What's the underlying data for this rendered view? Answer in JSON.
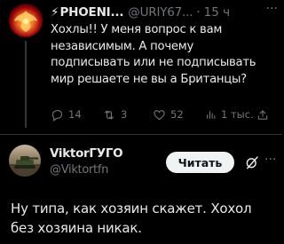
{
  "parent_tweet": {
    "bolt": "⚡",
    "author_name": "PHOENI...",
    "handle": "@URIY67...",
    "separator": "·",
    "time": "15 ч",
    "more": "···",
    "text_lines": [
      "Хохлы!! У меня вопрос к вам",
      "независимым. А почему",
      "подписывать или не подписывать",
      "мир решаете не вы а Британцы?"
    ],
    "actions": {
      "replies": "14",
      "reposts": "3",
      "likes": "52",
      "views": "1 тыс."
    }
  },
  "reply_tweet": {
    "author_name": "ViktorГУГО",
    "handle": "@Viktortfn",
    "follow_label": "Читать",
    "more": "···",
    "text_lines": [
      "Ну типа, как хозяин скажет. Хохол",
      "без хозяина никак."
    ]
  },
  "colors": {
    "background": "#000000",
    "text": "#e7e9ea",
    "muted": "#71767b",
    "divider": "#2f3336",
    "button_bg": "#eff3f4"
  },
  "icons": [
    "reply-icon",
    "repost-icon",
    "like-icon",
    "views-icon",
    "share-icon",
    "grok-icon",
    "more-icon"
  ]
}
